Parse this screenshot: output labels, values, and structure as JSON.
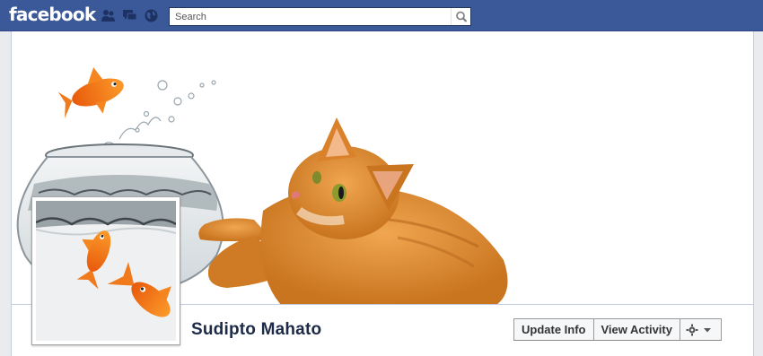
{
  "topbar": {
    "logo": "facebook",
    "icons": [
      "friend-requests-icon",
      "messages-icon",
      "notifications-globe-icon",
      "search-icon"
    ],
    "search_placeholder": "Search"
  },
  "profile": {
    "name": "Sudipto Mahato"
  },
  "actions": {
    "update_info": "Update Info",
    "view_activity": "View Activity",
    "settings_icons": [
      "gear-icon",
      "caret-down-icon"
    ]
  },
  "colors": {
    "brand_blue": "#3b5998",
    "name_text": "#1c2a47",
    "cat_orange": "#d9822b",
    "goldfish_orange": "#f26b12"
  }
}
